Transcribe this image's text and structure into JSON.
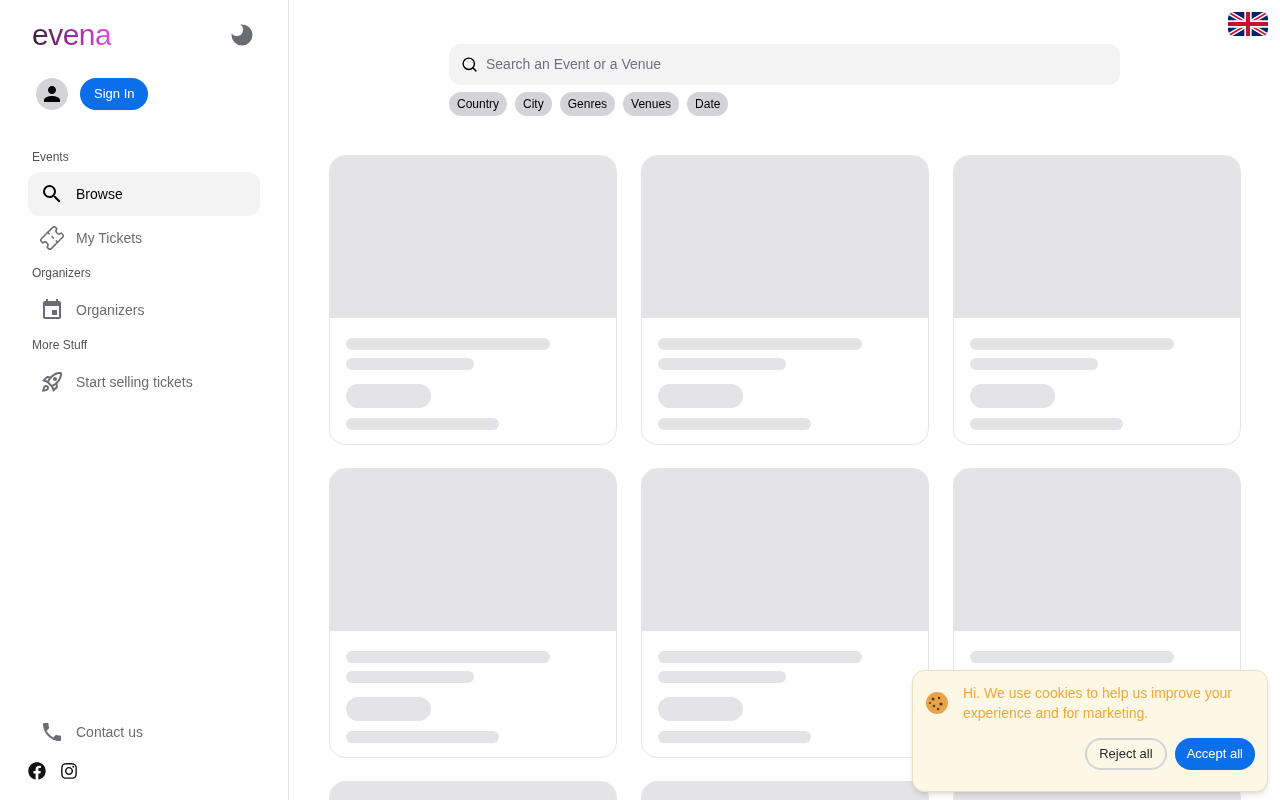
{
  "sidebar": {
    "logo": "evena",
    "sign_in": "Sign In",
    "sections": [
      {
        "title": "Events",
        "items": [
          {
            "label": "Browse",
            "kind": "search",
            "selected": true
          },
          {
            "label": "My Tickets",
            "kind": "ticket",
            "selected": false
          }
        ]
      },
      {
        "title": "Organizers",
        "items": [
          {
            "label": "Organizers",
            "kind": "calendar",
            "selected": false
          }
        ]
      },
      {
        "title": "More Stuff",
        "items": [
          {
            "label": "Start selling tickets",
            "kind": "rocket",
            "selected": false
          }
        ]
      }
    ],
    "contact": "Contact us"
  },
  "search": {
    "placeholder": "Search an Event or a Venue"
  },
  "filters": [
    "Country",
    "City",
    "Genres",
    "Venues",
    "Date"
  ],
  "cookie_banner": {
    "message": "Hi. We use cookies to help us improve your experience and for marketing.",
    "buttons": [
      {
        "label": "Reject all",
        "kind": "secondary"
      },
      {
        "label": "Accept all",
        "kind": "primary"
      }
    ]
  }
}
